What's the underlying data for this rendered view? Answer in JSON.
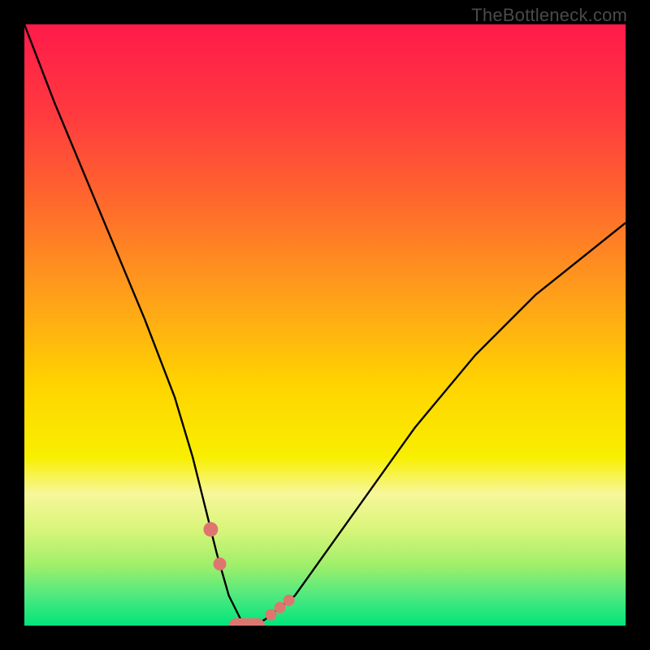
{
  "watermark": "TheBottleneck.com",
  "chart_data": {
    "type": "line",
    "title": "",
    "xlabel": "",
    "ylabel": "",
    "xlim": [
      0,
      100
    ],
    "ylim": [
      0,
      100
    ],
    "grid": false,
    "series": [
      {
        "name": "curve",
        "x": [
          0,
          5,
          10,
          15,
          20,
          25,
          28,
          30,
          32,
          34,
          36,
          38,
          40,
          45,
          50,
          55,
          60,
          65,
          70,
          75,
          80,
          85,
          90,
          95,
          100
        ],
        "values": [
          100,
          87,
          75,
          63,
          51,
          38,
          28,
          20,
          12,
          5,
          1,
          0,
          1,
          5,
          12,
          19,
          26,
          33,
          39,
          45,
          50,
          55,
          59,
          63,
          67
        ]
      }
    ],
    "highlight_region": {
      "name": "flat-bottom-highlight",
      "x_start": 31,
      "x_end": 44,
      "color": "#de766f"
    },
    "background": {
      "type": "vertical-gradient",
      "stops": [
        {
          "pos": 0.0,
          "color": "#ff1a4a"
        },
        {
          "pos": 0.15,
          "color": "#ff3a3f"
        },
        {
          "pos": 0.3,
          "color": "#ff6a2c"
        },
        {
          "pos": 0.45,
          "color": "#ff9f1a"
        },
        {
          "pos": 0.6,
          "color": "#ffd400"
        },
        {
          "pos": 0.72,
          "color": "#f8ef00"
        },
        {
          "pos": 0.78,
          "color": "#f7f79a"
        },
        {
          "pos": 0.84,
          "color": "#d9f57a"
        },
        {
          "pos": 0.9,
          "color": "#9fef6a"
        },
        {
          "pos": 0.95,
          "color": "#4fe97f"
        },
        {
          "pos": 1.0,
          "color": "#00e57a"
        }
      ]
    }
  }
}
